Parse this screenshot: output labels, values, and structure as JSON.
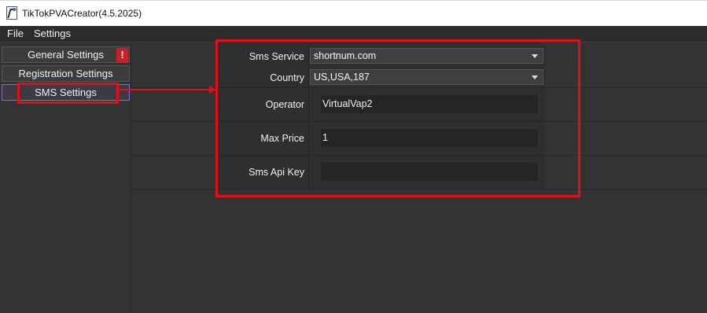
{
  "window": {
    "title": "TikTokPVACreator(4.5.2025)"
  },
  "menu": {
    "items": [
      "File",
      "Settings"
    ]
  },
  "sidebar": {
    "items": [
      {
        "label": "General Settings"
      },
      {
        "label": "Registration Settings"
      },
      {
        "label": "SMS Settings",
        "active": true
      }
    ],
    "warning_symbol": "!"
  },
  "form": {
    "sms_service": {
      "label": "Sms Service",
      "value": "shortnum.com"
    },
    "country": {
      "label": "Country",
      "value": "US,USA,187"
    },
    "operator": {
      "label": "Operator",
      "value": "VirtualVap2"
    },
    "max_price": {
      "label": "Max Price",
      "value": "1"
    },
    "sms_api_key": {
      "label": "Sms Api Key",
      "value": ""
    }
  },
  "colors": {
    "annotation": "#e0101a",
    "warning": "#c8202a",
    "active_border": "#8a6bbf",
    "background": "#333333"
  }
}
